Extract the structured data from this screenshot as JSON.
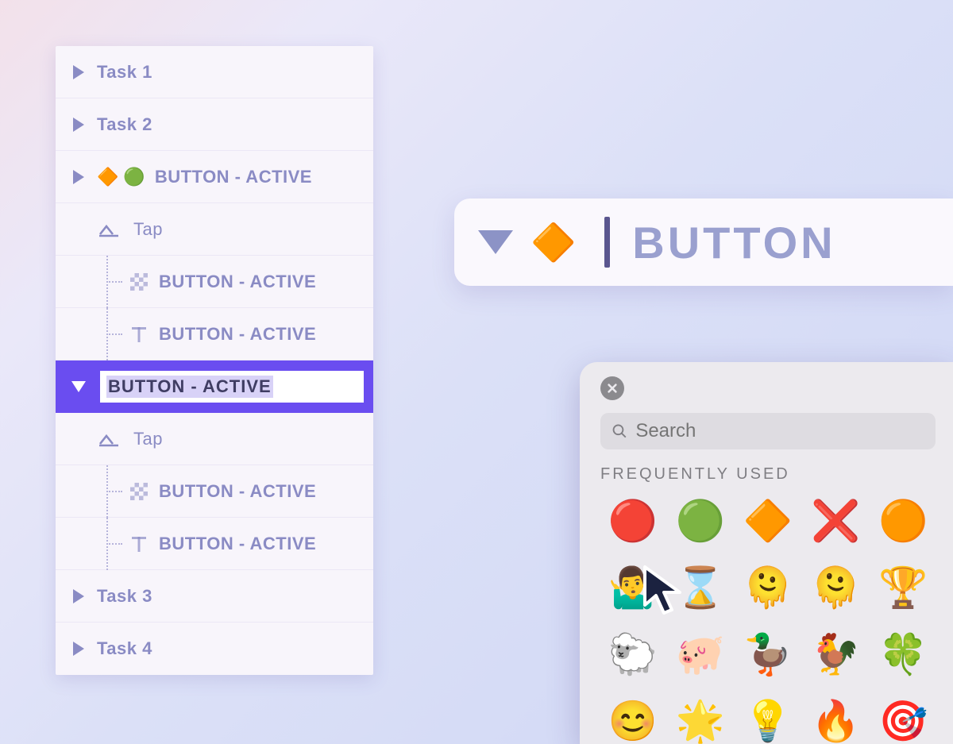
{
  "tree": {
    "task1": "Task 1",
    "task2": "Task 2",
    "group1": {
      "emoji1": "🔶",
      "emoji2": "🟢",
      "label": "BUTTON - ACTIVE",
      "tap": "Tap",
      "child_a": "BUTTON - ACTIVE",
      "child_b": "BUTTON - ACTIVE"
    },
    "selected": {
      "label": "BUTTON - ACTIVE",
      "tap": "Tap",
      "child_a": "BUTTON - ACTIVE",
      "child_b": "BUTTON - ACTIVE"
    },
    "task3": "Task 3",
    "task4": "Task 4"
  },
  "titlebar": {
    "emoji": "🔶",
    "label": "BUTTON"
  },
  "picker": {
    "search_placeholder": "Search",
    "section": "FREQUENTLY USED",
    "emojis": [
      "🔴",
      "🟢",
      "🔶",
      "❌",
      "🟠",
      "🤷‍♂️",
      "⌛",
      "🫠",
      "🫠",
      "🏆",
      "🐑",
      "🐖",
      "🦆",
      "🐓",
      "🍀",
      "😊",
      "🌟",
      "💡",
      "🔥",
      "🎯"
    ]
  }
}
